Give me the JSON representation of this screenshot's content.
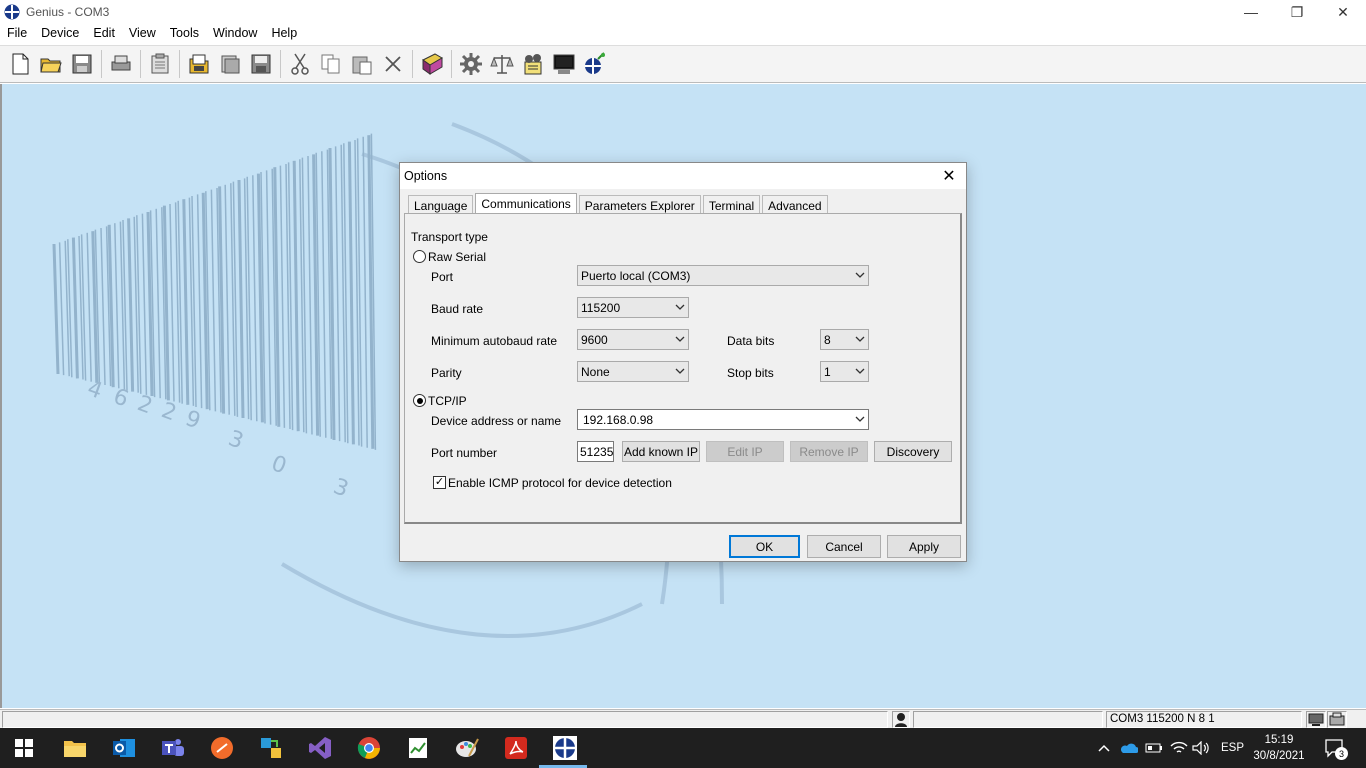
{
  "window": {
    "title": "Genius - COM3",
    "minimize_glyph": "—",
    "maximize_glyph": "❐",
    "close_glyph": "✕"
  },
  "menu": [
    "File",
    "Device",
    "Edit",
    "View",
    "Tools",
    "Window",
    "Help"
  ],
  "toolbar": {
    "groups": [
      [
        "new-file-icon",
        "open-folder-icon",
        "save-icon"
      ],
      [
        "print-icon"
      ],
      [
        "properties-icon"
      ],
      [
        "open-device-icon",
        "copy-document-icon",
        "save-device-icon"
      ],
      [
        "cut-icon",
        "copy-icon",
        "paste-icon",
        "delete-icon"
      ],
      [
        "book-icon"
      ],
      [
        "gear-icon",
        "scale-icon",
        "settings-gears-icon",
        "terminal-icon",
        "connect-icon"
      ]
    ]
  },
  "dialog": {
    "title": "Options",
    "close_glyph": "✕",
    "tabs": [
      "Language",
      "Communications",
      "Parameters Explorer",
      "Terminal",
      "Advanced"
    ],
    "active_tab": "Communications",
    "transport_type_label": "Transport type",
    "raw_serial_label": "Raw Serial",
    "raw_serial_selected": false,
    "port_label": "Port",
    "port_value": "Puerto local (COM3)",
    "baud_rate_label": "Baud rate",
    "baud_rate_value": "115200",
    "min_autobaud_label": "Minimum autobaud rate",
    "min_autobaud_value": "9600",
    "data_bits_label": "Data bits",
    "data_bits_value": "8",
    "parity_label": "Parity",
    "parity_value": "None",
    "stop_bits_label": "Stop bits",
    "stop_bits_value": "1",
    "tcpip_label": "TCP/IP",
    "tcpip_selected": true,
    "device_address_label": "Device address or name",
    "device_address_value": "192.168.0.98",
    "port_number_label": "Port number",
    "port_number_value": "51235",
    "add_known_ip_label": "Add known IP",
    "edit_ip_label": "Edit IP",
    "remove_ip_label": "Remove IP",
    "discovery_label": "Discovery",
    "icmp_label": "Enable ICMP protocol for device detection",
    "icmp_checked": true,
    "check_glyph": "✓",
    "ok_label": "OK",
    "cancel_label": "Cancel",
    "apply_label": "Apply"
  },
  "statusbar": {
    "connection_info": "COM3 115200 N 8 1"
  },
  "taskbar": {
    "apps": [
      "windows-start-icon",
      "file-explorer-icon",
      "outlook-icon",
      "teams-icon",
      "sublime-icon",
      "ide-icon",
      "visual-studio-icon",
      "chrome-icon",
      "notepad-icon",
      "paint-icon",
      "acrobat-icon",
      "genius-icon"
    ],
    "language": "ESP",
    "time": "15:19",
    "date": "30/8/2021",
    "notification_count": "3"
  },
  "colors": {
    "workspace_bg": "#c5e2f5",
    "accent": "#0078d7",
    "taskbar_bg": "#1f1f1f"
  }
}
